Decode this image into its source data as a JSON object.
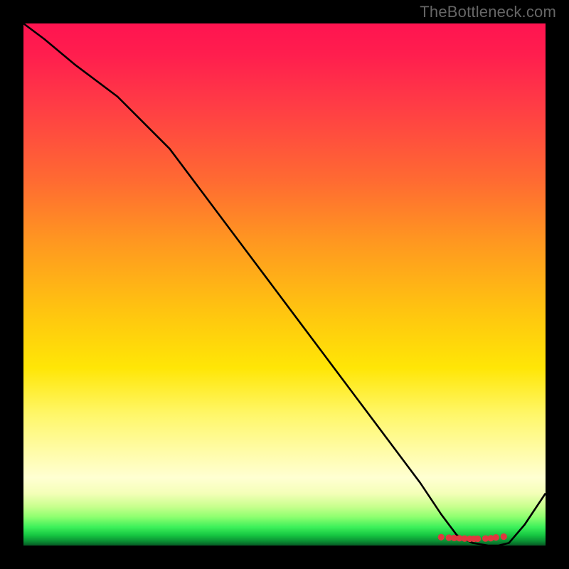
{
  "watermark": "TheBottleneck.com",
  "colors": {
    "line": "#000000",
    "marker": "#e0383f"
  },
  "chart_data": {
    "type": "line",
    "title": "",
    "xlabel": "",
    "ylabel": "",
    "xlim": [
      0,
      100
    ],
    "ylim": [
      0,
      100
    ],
    "x": [
      0,
      4,
      10,
      18,
      24,
      28,
      34,
      40,
      46,
      52,
      58,
      64,
      70,
      76,
      80,
      83,
      86,
      89,
      91,
      93,
      96,
      100
    ],
    "values": [
      100,
      97,
      92,
      86,
      80,
      76,
      68,
      60,
      52,
      44,
      36,
      28,
      20,
      12,
      6,
      2,
      0.5,
      0,
      0,
      0.5,
      4,
      10
    ],
    "series": [
      {
        "name": "bottleneck-curve",
        "x_ref": "x",
        "y_ref": "values"
      }
    ],
    "markers": {
      "name": "trough-cluster",
      "x": [
        80.0,
        81.5,
        82.5,
        83.5,
        84.5,
        85.5,
        86.3,
        87.0,
        88.5,
        89.5,
        90.5,
        92.0
      ],
      "values": [
        1.6,
        1.5,
        1.45,
        1.4,
        1.35,
        1.3,
        1.3,
        1.3,
        1.35,
        1.4,
        1.55,
        1.7
      ]
    }
  }
}
